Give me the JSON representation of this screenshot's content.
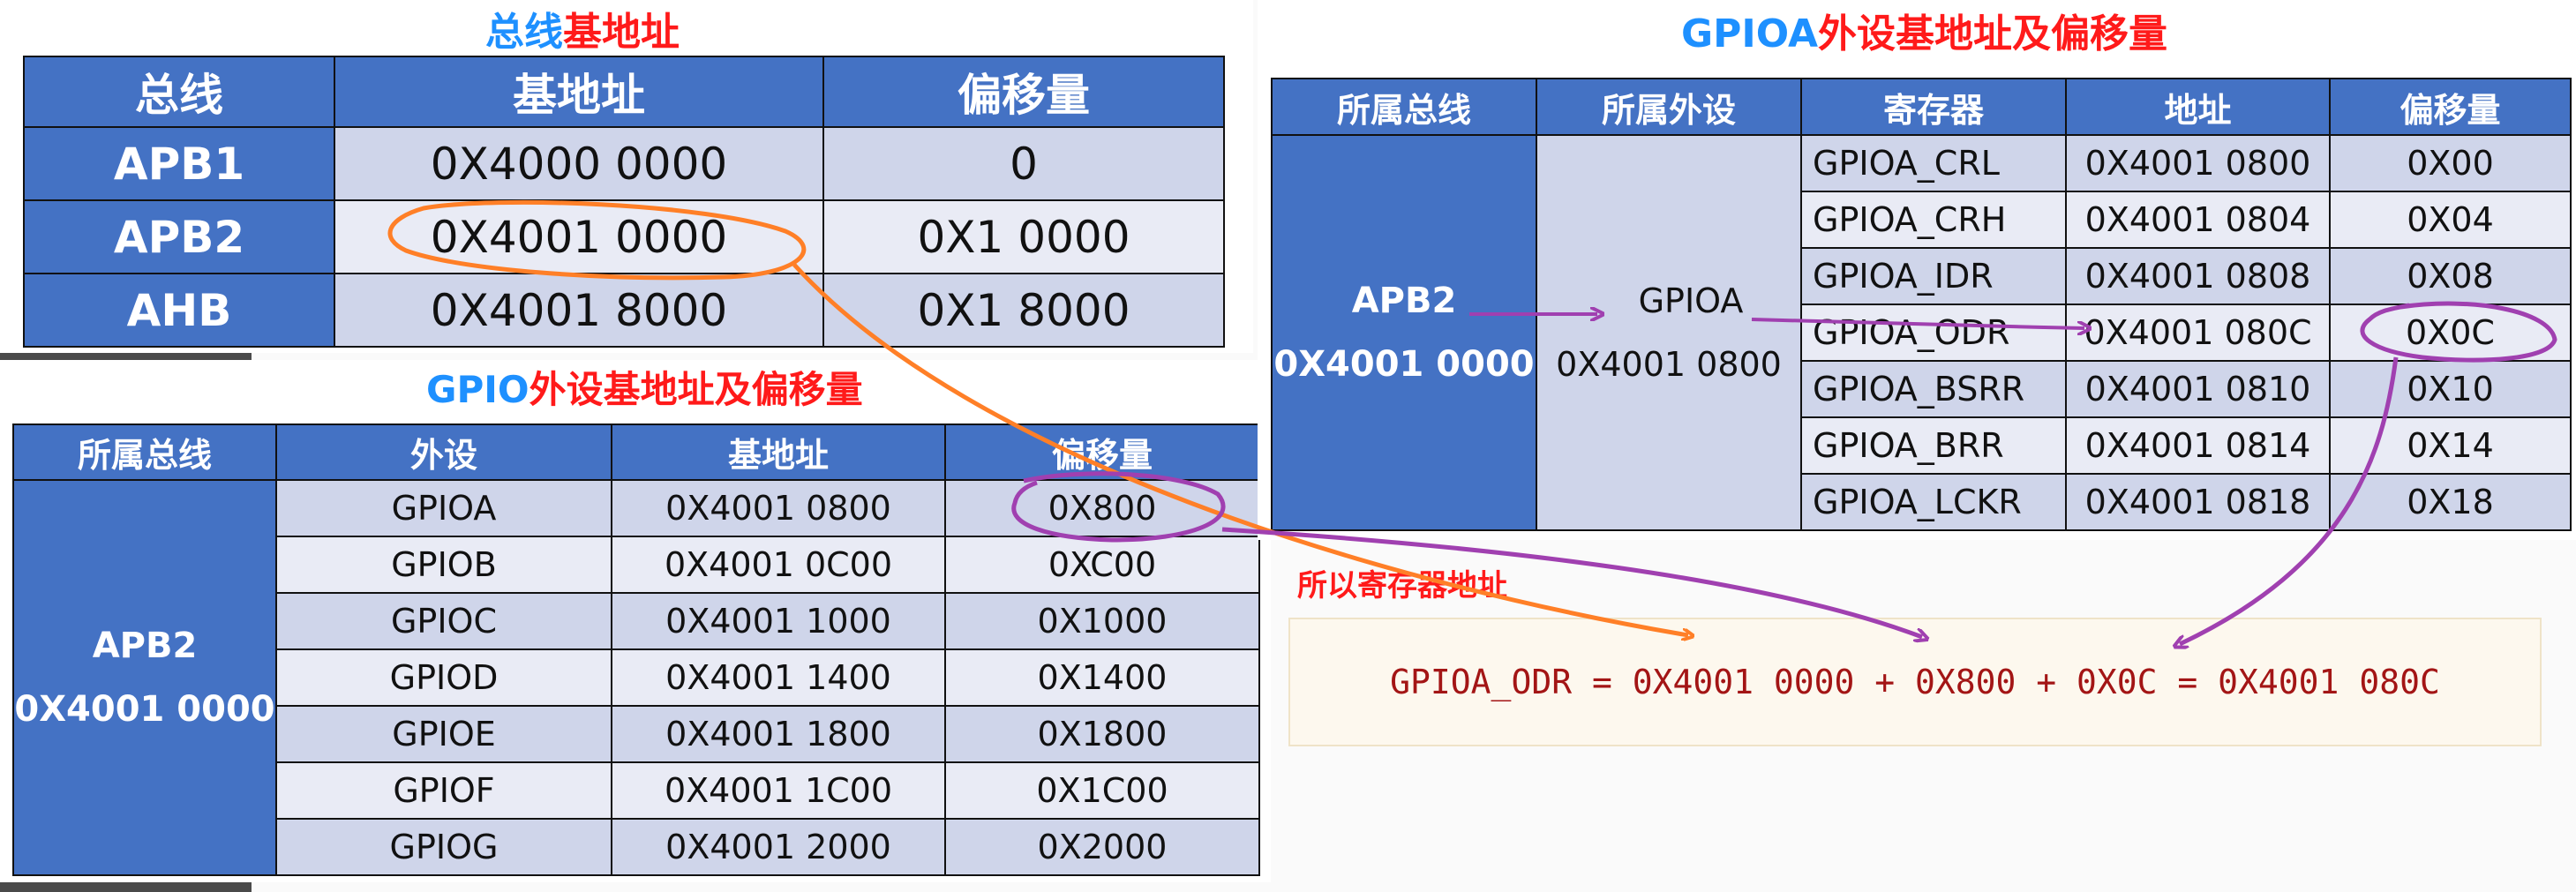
{
  "bus_panel": {
    "title_blue": "总线",
    "title_red": "基地址",
    "headers": [
      "总线",
      "基地址",
      "偏移量"
    ],
    "rows": [
      [
        "APB1",
        "0X4000 0000",
        "0"
      ],
      [
        "APB2",
        "0X4001 0000",
        "0X1 0000"
      ],
      [
        "AHB",
        "0X4001 8000",
        "0X1 8000"
      ]
    ]
  },
  "gpio_panel": {
    "title_blue": "GPIO",
    "title_red": "外设基地址及偏移量",
    "headers": [
      "所属总线",
      "外设",
      "基地址",
      "偏移量"
    ],
    "bus_name": "APB2",
    "bus_addr": "0X4001 0000",
    "rows": [
      [
        "GPIOA",
        "0X4001 0800",
        "0X800"
      ],
      [
        "GPIOB",
        "0X4001 0C00",
        "0XC00"
      ],
      [
        "GPIOC",
        "0X4001 1000",
        "0X1000"
      ],
      [
        "GPIOD",
        "0X4001 1400",
        "0X1400"
      ],
      [
        "GPIOE",
        "0X4001 1800",
        "0X1800"
      ],
      [
        "GPIOF",
        "0X4001 1C00",
        "0X1C00"
      ],
      [
        "GPIOG",
        "0X4001 2000",
        "0X2000"
      ]
    ]
  },
  "gpioa_panel": {
    "title_blue": "GPIOA",
    "title_red": "外设基地址及偏移量",
    "headers": [
      "所属总线",
      "所属外设",
      "寄存器",
      "地址",
      "偏移量"
    ],
    "bus_name": "APB2",
    "bus_addr": "0X4001 0000",
    "periph_name": "GPIOA",
    "periph_addr": "0X4001 0800",
    "rows": [
      [
        "GPIOA_CRL",
        "0X4001 0800",
        "0X00"
      ],
      [
        "GPIOA_CRH",
        "0X4001 0804",
        "0X04"
      ],
      [
        "GPIOA_IDR",
        "0X4001 0808",
        "0X08"
      ],
      [
        "GPIOA_ODR",
        "0X4001 080C",
        "0X0C"
      ],
      [
        "GPIOA_BSRR",
        "0X4001 0810",
        "0X10"
      ],
      [
        "GPIOA_BRR",
        "0X4001 0814",
        "0X14"
      ],
      [
        "GPIOA_LCKR",
        "0X4001 0818",
        "0X18"
      ]
    ]
  },
  "conclusion": {
    "label": "所以寄存器地址",
    "formula": "GPIOA_ODR = 0X4001 0000 + 0X800 + 0X0C = 0X4001 080C"
  },
  "colors": {
    "header_blue": "#4472c4",
    "row_light": "#cfd5ea",
    "row_lighter": "#e9ebf5",
    "title_blue": "#1e90ff",
    "title_red": "#ff1a1a",
    "orange_annotation": "#ff7f27",
    "purple_annotation": "#a040b0"
  }
}
